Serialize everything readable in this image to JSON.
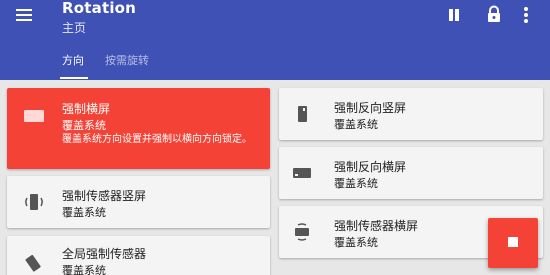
{
  "appbar": {
    "title": "Rotation",
    "subtitle": "主页",
    "color": "#3f51b5"
  },
  "actions": {
    "pause_icon": "pause-icon",
    "lock_icon": "lock-icon",
    "more_icon": "more-vert-icon"
  },
  "tabs": [
    {
      "label": "方向",
      "active": true
    },
    {
      "label": "按需旋转",
      "active": false
    }
  ],
  "modes": [
    {
      "title": "强制横屏",
      "subtitle": "覆盖系统",
      "description": "覆盖系统方向设置并强制以横向方向锁定。",
      "icon": "landscape-icon",
      "selected": true
    },
    {
      "title": "强制反向竖屏",
      "subtitle": "覆盖系统",
      "icon": "reverse-portrait-icon"
    },
    {
      "title": "强制传感器竖屏",
      "subtitle": "覆盖系统",
      "icon": "sensor-portrait-icon"
    },
    {
      "title": "强制反向横屏",
      "subtitle": "覆盖系统",
      "icon": "reverse-landscape-icon"
    },
    {
      "title": "全局强制传感器",
      "subtitle": "覆盖系统",
      "icon": "full-sensor-icon"
    },
    {
      "title": "强制传感器横屏",
      "subtitle": "覆盖系统",
      "icon": "sensor-landscape-icon"
    }
  ],
  "fab": {
    "icon": "stop-icon",
    "color": "#f44336"
  }
}
